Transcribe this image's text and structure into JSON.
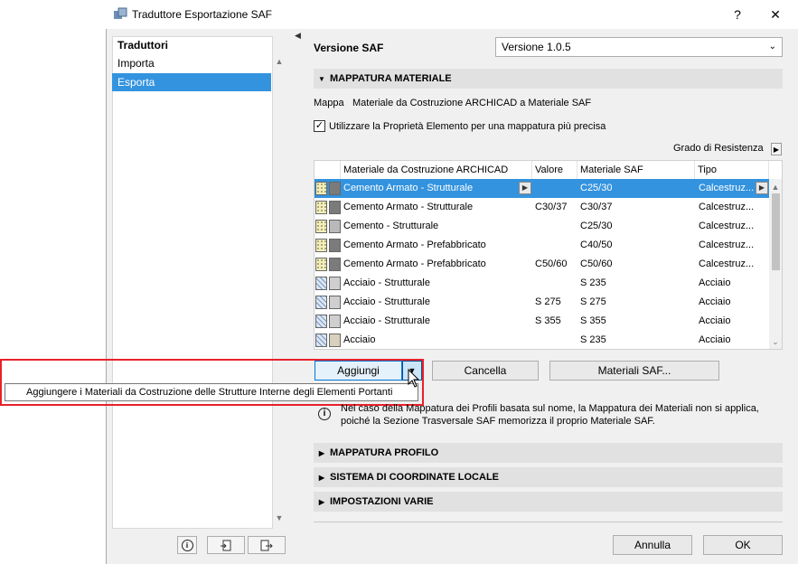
{
  "window": {
    "title": "Traduttore Esportazione SAF",
    "help_label": "?",
    "close_label": "✕"
  },
  "left_pane": {
    "header": "Traduttori",
    "items": [
      {
        "label": "Importa",
        "selected": false
      },
      {
        "label": "Esporta",
        "selected": true
      }
    ],
    "bottom_icons": [
      "info-icon",
      "import-icon",
      "export-icon"
    ]
  },
  "version": {
    "label": "Versione SAF",
    "value": "Versione 1.0.5"
  },
  "material_mapping": {
    "section_label": "MAPPATURA MATERIALE",
    "description_prefix": "Mappa",
    "description": "Materiale da Costruzione ARCHICAD a Materiale SAF",
    "checkbox_label": "Utilizzare la Proprietà Elemento per una mappatura più precisa",
    "checkbox_checked": true,
    "resistance_label": "Grado di Resistenza",
    "columns": [
      "Materiale da Costruzione ARCHICAD",
      "Valore",
      "Materiale SAF",
      "Tipo"
    ],
    "rows": [
      {
        "material": "Cemento Armato - Strutturale",
        "value": "",
        "saf": "C25/30",
        "type": "Calcestruz...",
        "kind": "concrete",
        "selected": true
      },
      {
        "material": "Cemento Armato - Strutturale",
        "value": "C30/37",
        "saf": "C30/37",
        "type": "Calcestruz...",
        "kind": "concrete",
        "selected": false
      },
      {
        "material": "Cemento - Strutturale",
        "value": "",
        "saf": "C25/30",
        "type": "Calcestruz...",
        "kind": "concrete-light",
        "selected": false
      },
      {
        "material": "Cemento Armato - Prefabbricato",
        "value": "",
        "saf": "C40/50",
        "type": "Calcestruz...",
        "kind": "concrete",
        "selected": false
      },
      {
        "material": "Cemento Armato - Prefabbricato",
        "value": "C50/60",
        "saf": "C50/60",
        "type": "Calcestruz...",
        "kind": "concrete",
        "selected": false
      },
      {
        "material": "Acciaio - Strutturale",
        "value": "",
        "saf": "S 235",
        "type": "Acciaio",
        "kind": "steel",
        "selected": false
      },
      {
        "material": "Acciaio - Strutturale",
        "value": "S 275",
        "saf": "S 275",
        "type": "Acciaio",
        "kind": "steel",
        "selected": false
      },
      {
        "material": "Acciaio - Strutturale",
        "value": "S 355",
        "saf": "S 355",
        "type": "Acciaio",
        "kind": "steel",
        "selected": false
      },
      {
        "material": "Acciaio",
        "value": "",
        "saf": "S 235",
        "type": "Acciaio",
        "kind": "steel-light",
        "selected": false
      }
    ],
    "buttons": {
      "add": "Aggiungi",
      "delete": "Cancella",
      "saf_materials": "Materiali SAF..."
    },
    "tooltip": "Aggiungere i Materiali da Costruzione delle Strutture Interne degli Elementi Portanti",
    "note_line1": "Nel caso della Mappatura dei Profili basata sul nome, la Mappatura dei Materiali non si applica,",
    "note_line2": "poiché la Sezione Trasversale SAF memorizza il proprio Materiale SAF."
  },
  "sections": {
    "profile": "MAPPATURA PROFILO",
    "local_coords": "SISTEMA DI COORDINATE LOCALE",
    "misc": "IMPOSTAZIONI VARIE"
  },
  "footer": {
    "cancel": "Annulla",
    "ok": "OK"
  },
  "colors": {
    "selection": "#3393df",
    "highlight": "#e8212b"
  }
}
